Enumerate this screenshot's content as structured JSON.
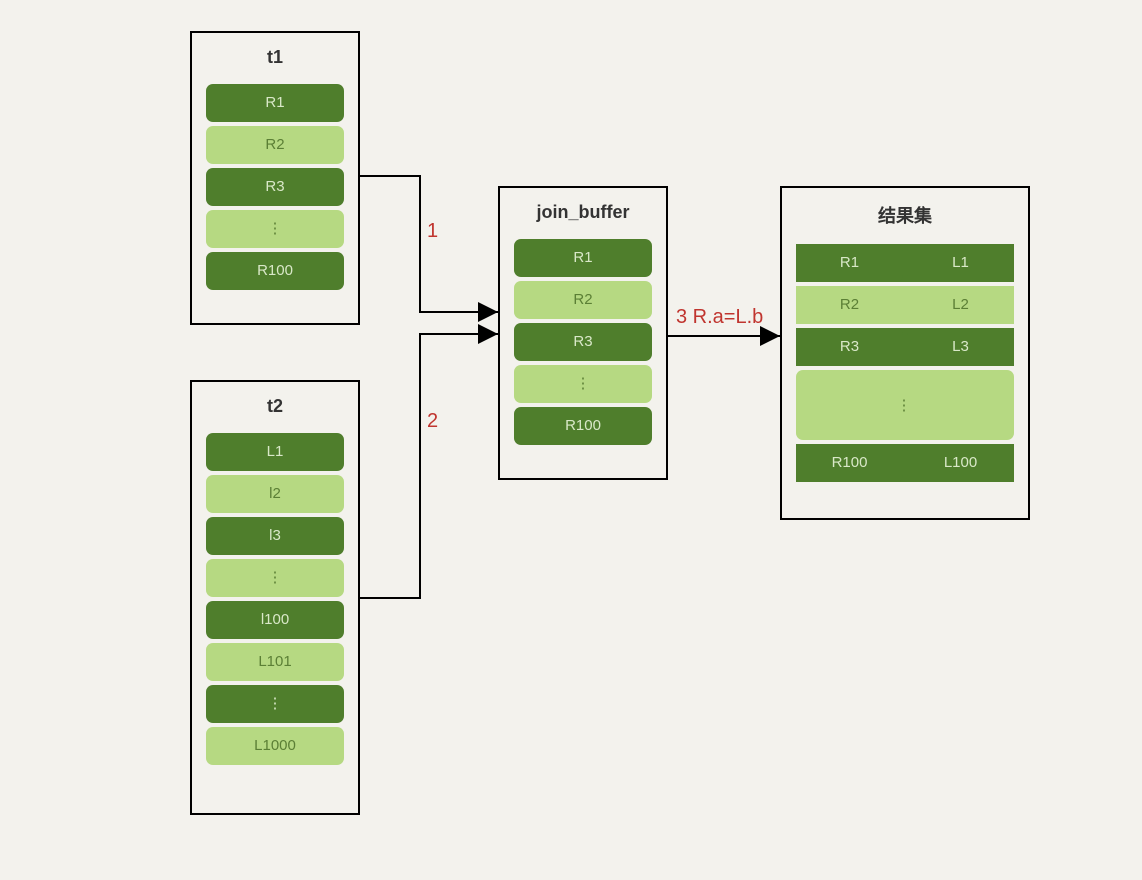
{
  "colors": {
    "background": "#f3f2ed",
    "rowDark": "#4f7e2c",
    "rowDarkText": "#d9e8c8",
    "rowLight": "#b6d982",
    "rowLightText": "#5b7f35",
    "edgeRed": "#c0352f"
  },
  "t1": {
    "title": "t1",
    "rows": [
      {
        "text": "R1",
        "shade": "dark"
      },
      {
        "text": "R2",
        "shade": "light"
      },
      {
        "text": "R3",
        "shade": "dark"
      },
      {
        "text": "⋮",
        "shade": "light"
      },
      {
        "text": "R100",
        "shade": "dark"
      }
    ]
  },
  "t2": {
    "title": "t2",
    "rows": [
      {
        "text": "L1",
        "shade": "dark"
      },
      {
        "text": "l2",
        "shade": "light"
      },
      {
        "text": "l3",
        "shade": "dark"
      },
      {
        "text": "⋮",
        "shade": "light"
      },
      {
        "text": "l100",
        "shade": "dark"
      },
      {
        "text": "L101",
        "shade": "light"
      },
      {
        "text": "⋮",
        "shade": "dark"
      },
      {
        "text": "L1000",
        "shade": "light"
      }
    ]
  },
  "joinBuffer": {
    "title": "join_buffer",
    "rows": [
      {
        "text": "R1",
        "shade": "dark"
      },
      {
        "text": "R2",
        "shade": "light"
      },
      {
        "text": "R3",
        "shade": "dark"
      },
      {
        "text": "⋮",
        "shade": "light"
      },
      {
        "text": "R100",
        "shade": "dark"
      }
    ]
  },
  "result": {
    "title": "结果集",
    "rows": [
      {
        "left": "R1",
        "right": "L1",
        "shade": "dark",
        "kind": "split"
      },
      {
        "left": "R2",
        "right": "L2",
        "shade": "light",
        "kind": "split"
      },
      {
        "left": "R3",
        "right": "L3",
        "shade": "dark",
        "kind": "split"
      },
      {
        "text": "⋮",
        "shade": "light",
        "kind": "full"
      },
      {
        "left": "R100",
        "right": "L100",
        "shade": "dark",
        "kind": "split"
      }
    ]
  },
  "edges": {
    "e1": {
      "label": "1"
    },
    "e2": {
      "label": "2"
    },
    "e3": {
      "label": "3 R.a=L.b"
    }
  }
}
